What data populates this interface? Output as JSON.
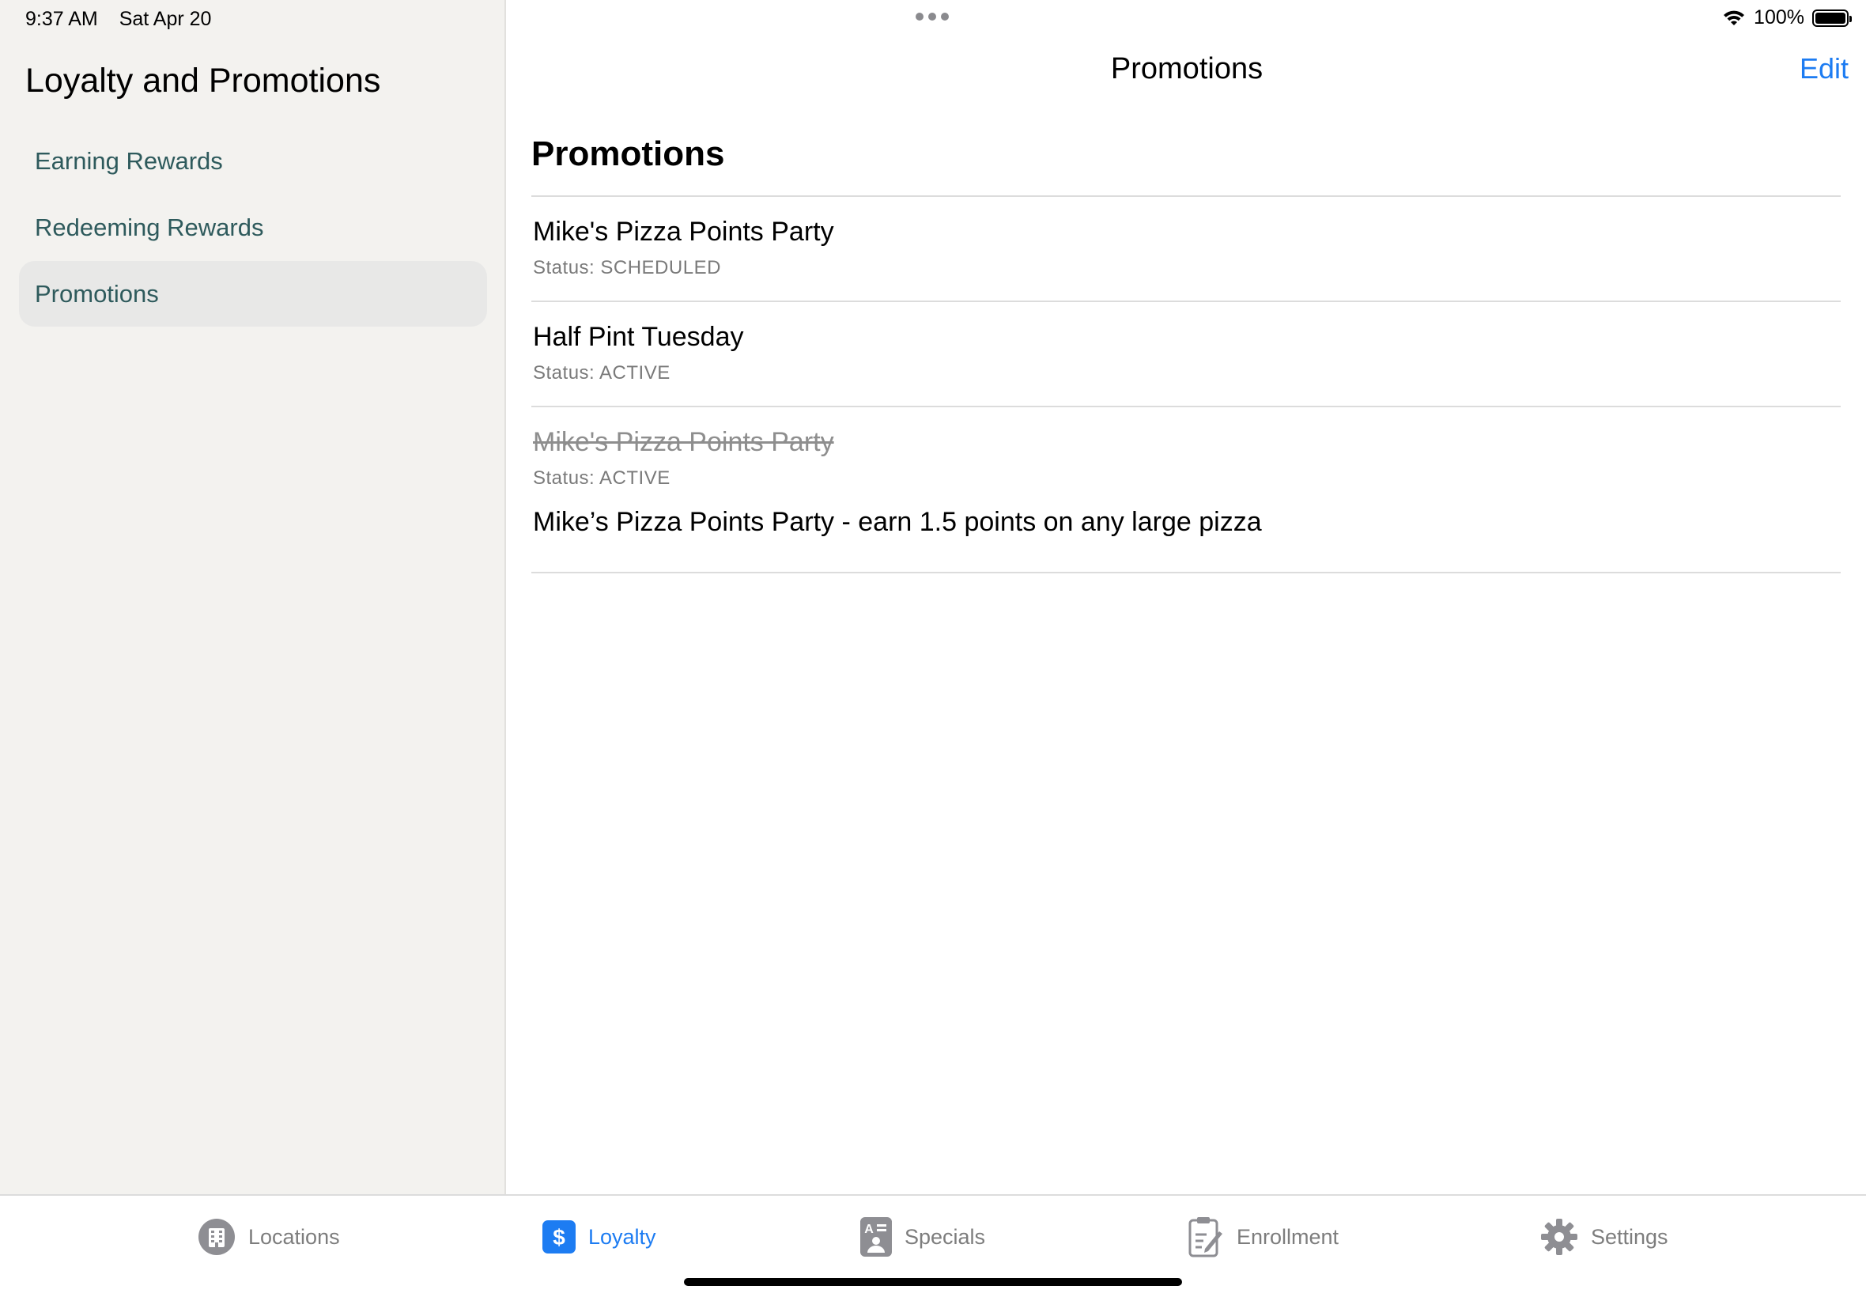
{
  "status_bar": {
    "time": "9:37 AM",
    "date": "Sat Apr 20",
    "battery": "100%"
  },
  "sidebar": {
    "title": "Loyalty and Promotions",
    "items": [
      {
        "label": "Earning Rewards",
        "selected": false
      },
      {
        "label": "Redeeming Rewards",
        "selected": false
      },
      {
        "label": "Promotions",
        "selected": true
      }
    ]
  },
  "main": {
    "nav_title": "Promotions",
    "edit_label": "Edit",
    "section_title": "Promotions",
    "promotions": [
      {
        "name": "Mike's Pizza Points Party",
        "status": "Status: SCHEDULED",
        "struck": false
      },
      {
        "name": "Half Pint Tuesday",
        "status": "Status: ACTIVE",
        "struck": false
      },
      {
        "name": "Mike's Pizza Points Party",
        "status": "Status: ACTIVE",
        "struck": true,
        "description": "Mike’s Pizza Points Party - earn 1.5 points on any large pizza"
      }
    ]
  },
  "tabbar": {
    "tabs": [
      {
        "label": "Locations",
        "icon": "building-icon",
        "active": false
      },
      {
        "label": "Loyalty",
        "icon": "dollar-icon",
        "active": true
      },
      {
        "label": "Specials",
        "icon": "specials-icon",
        "active": false
      },
      {
        "label": "Enrollment",
        "icon": "clipboard-pen-icon",
        "active": false
      },
      {
        "label": "Settings",
        "icon": "gear-icon",
        "active": false
      }
    ]
  },
  "colors": {
    "accent": "#1d7cf2",
    "sidebar_text": "#2e5a5c",
    "sidebar_bg": "#f3f2ef"
  }
}
